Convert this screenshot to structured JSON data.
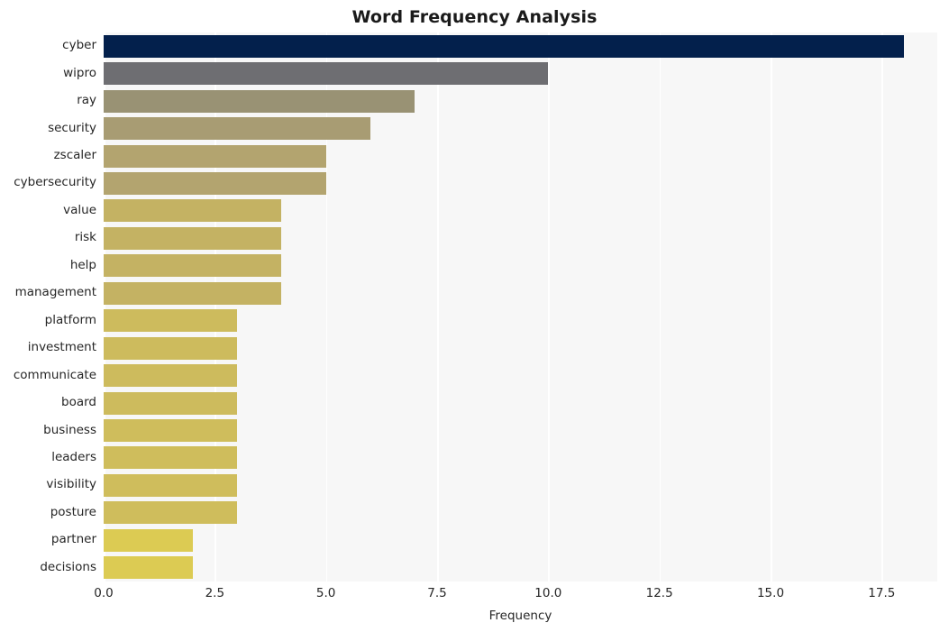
{
  "chart_data": {
    "type": "bar",
    "orientation": "horizontal",
    "title": "Word Frequency Analysis",
    "xlabel": "Frequency",
    "ylabel": "",
    "categories": [
      "cyber",
      "wipro",
      "ray",
      "security",
      "zscaler",
      "cybersecurity",
      "value",
      "risk",
      "help",
      "management",
      "platform",
      "investment",
      "communicate",
      "board",
      "business",
      "leaders",
      "visibility",
      "posture",
      "partner",
      "decisions"
    ],
    "values": [
      18,
      10,
      7,
      6,
      5,
      5,
      4,
      4,
      4,
      4,
      3,
      3,
      3,
      3,
      3,
      3,
      3,
      3,
      2,
      2
    ],
    "bar_colors": [
      "#03204c",
      "#6e6e72",
      "#999274",
      "#a89c73",
      "#b3a46f",
      "#b3a46f",
      "#c4b263",
      "#c4b263",
      "#c4b263",
      "#c4b263",
      "#cdbb5d",
      "#cdbb5d",
      "#cdbb5d",
      "#cdbb5d",
      "#cfbd5c",
      "#cfbd5c",
      "#cfbd5c",
      "#cfbd5c",
      "#dccb53",
      "#dccb53"
    ],
    "xlim": [
      0,
      18.75
    ],
    "xticks": [
      0.0,
      2.5,
      5.0,
      7.5,
      10.0,
      12.5,
      15.0,
      17.5
    ],
    "xtick_labels": [
      "0.0",
      "2.5",
      "5.0",
      "7.5",
      "10.0",
      "12.5",
      "15.0",
      "17.5"
    ],
    "grid": true,
    "grid_axis": "x",
    "grid_color": "#ffffff",
    "plot_background": "#f7f7f7",
    "figure_background": "#ffffff",
    "legend": null
  }
}
